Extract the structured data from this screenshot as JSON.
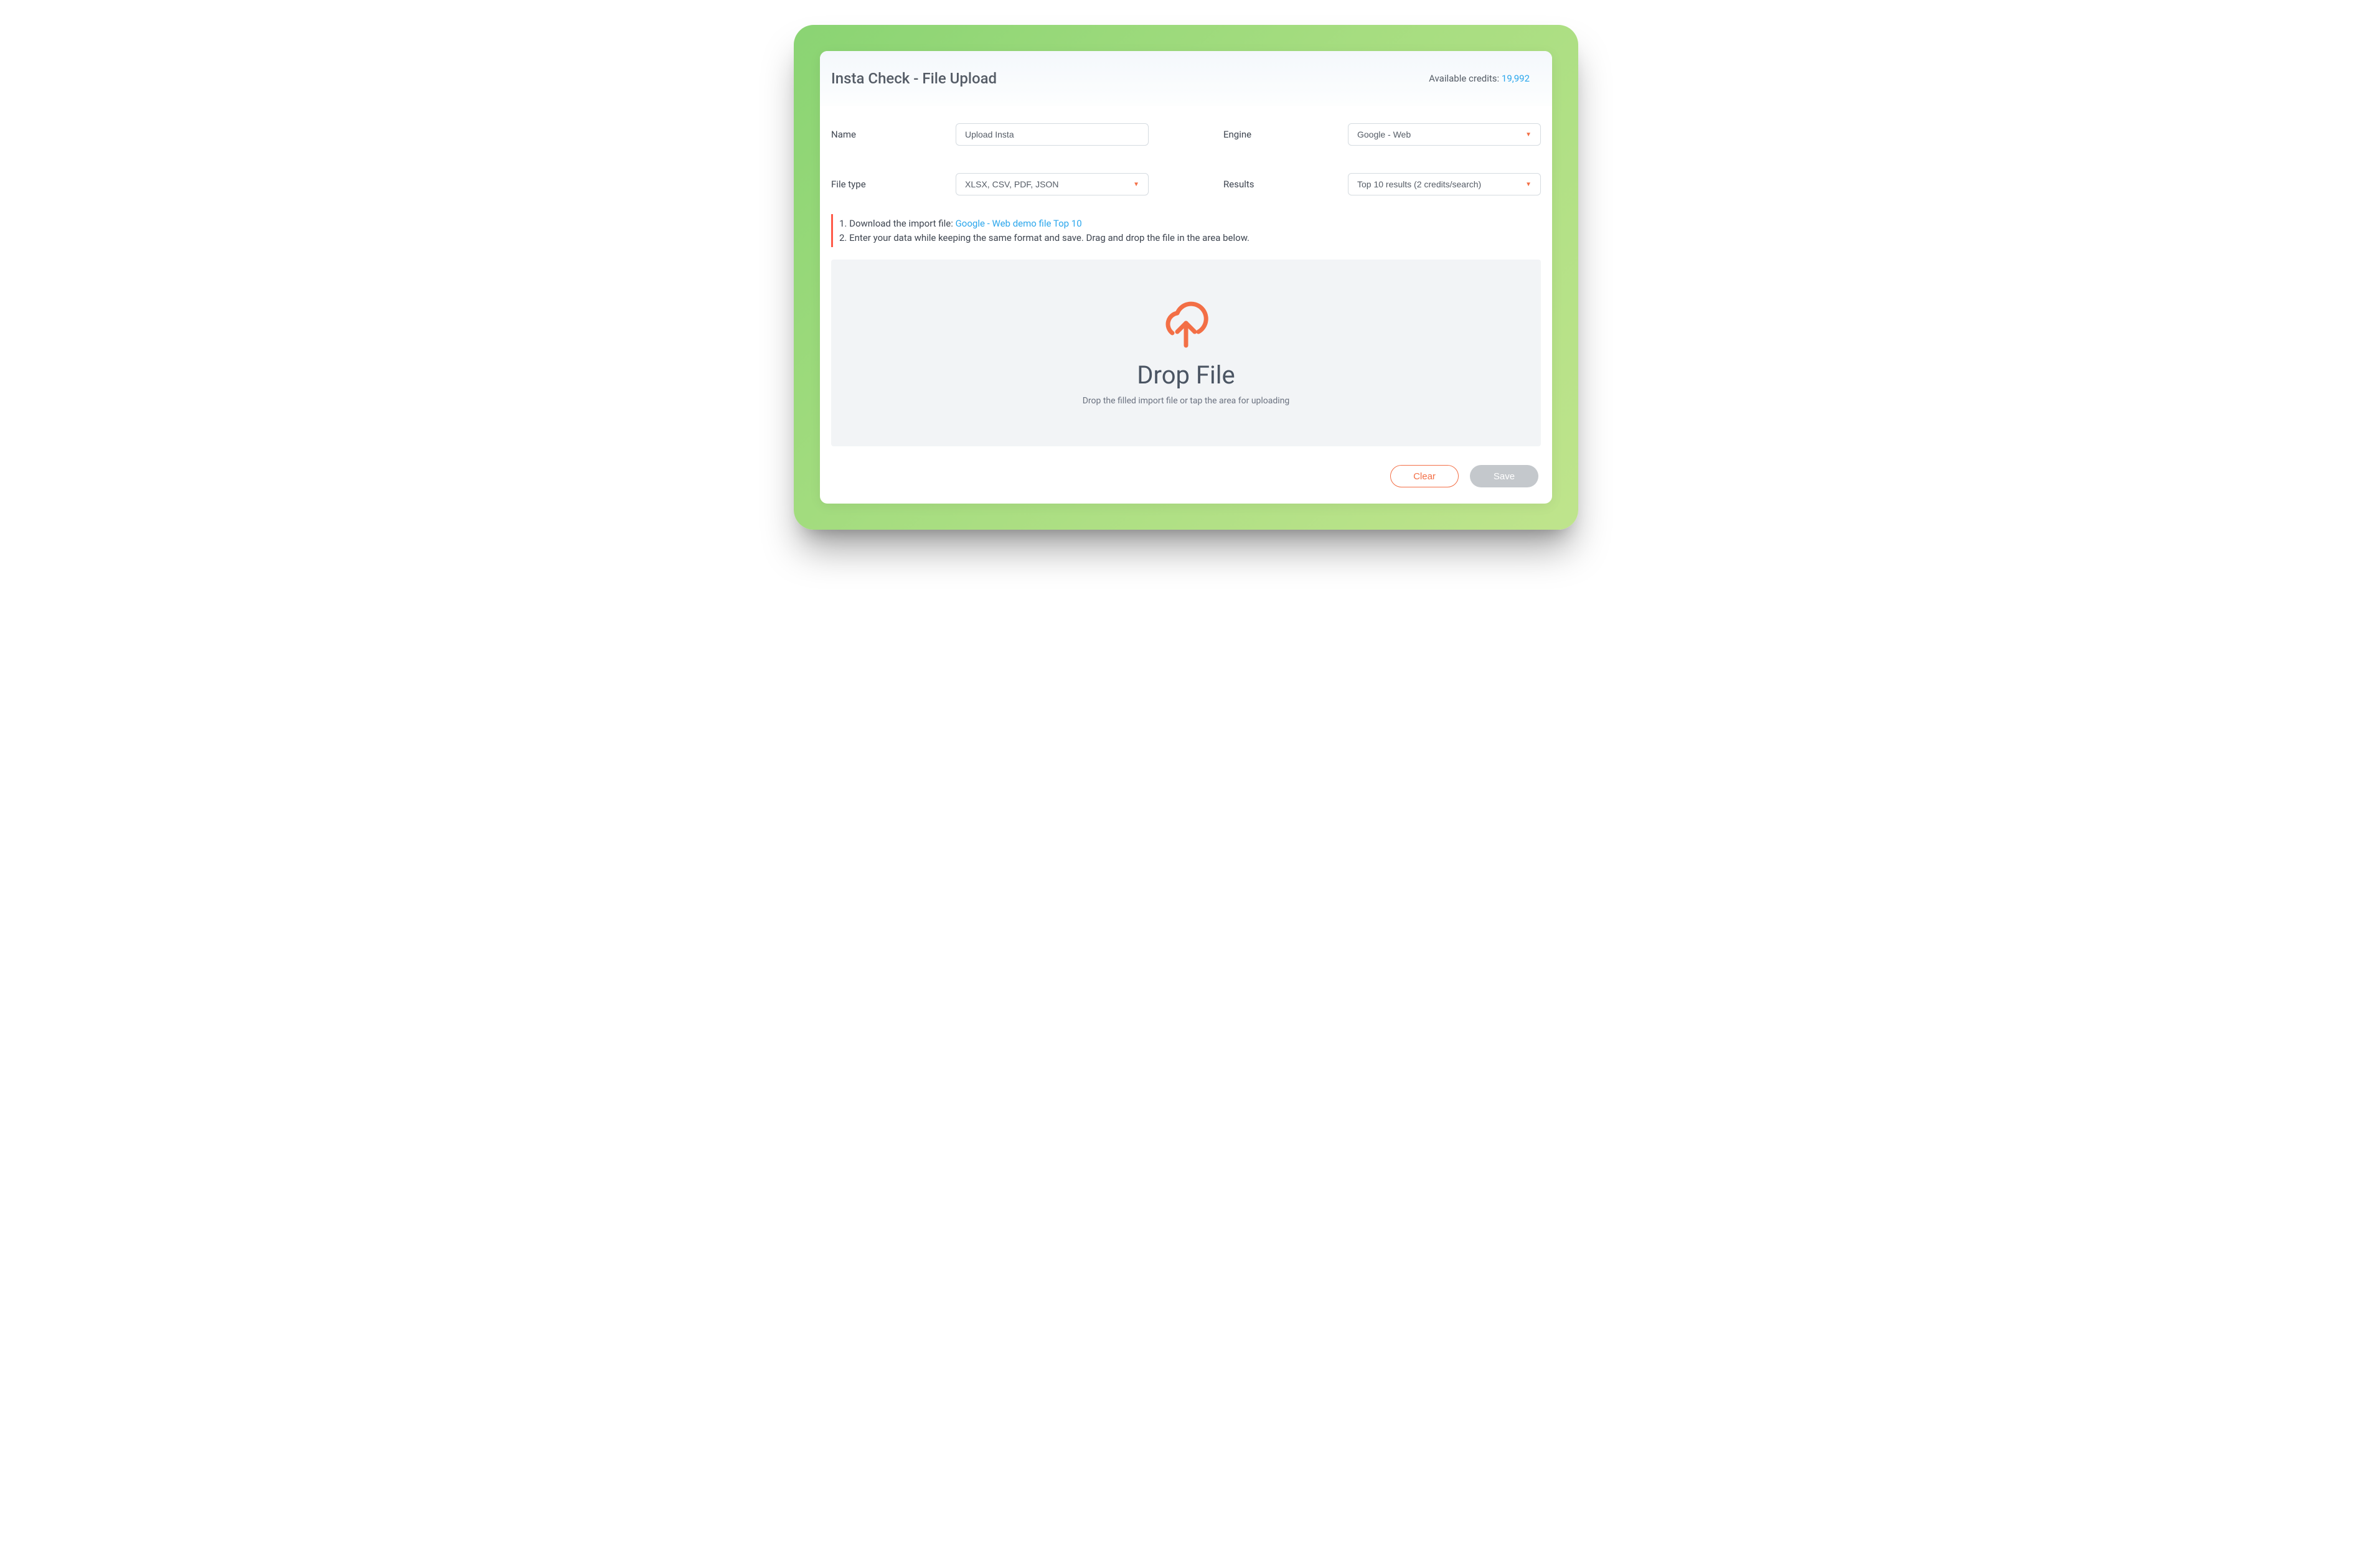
{
  "header": {
    "title": "Insta Check - File Upload",
    "credits_label": "Available credits: ",
    "credits_value": "19,992"
  },
  "form": {
    "name_label": "Name",
    "name_value": "Upload Insta",
    "engine_label": "Engine",
    "engine_value": "Google - Web",
    "file_type_label": "File type",
    "file_type_value": "XLSX, CSV, PDF, JSON",
    "results_label": "Results",
    "results_value": "Top 10 results (2 credits/search)"
  },
  "instructions": {
    "step1_prefix": "1. Download the import file: ",
    "step1_link": "Google - Web demo file Top 10",
    "step2": "2. Enter your data while keeping the same format and save. Drag and drop the file in the area below."
  },
  "drop": {
    "title": "Drop File",
    "subtitle": "Drop the filled import file or tap the area for uploading"
  },
  "actions": {
    "clear": "Clear",
    "save": "Save"
  }
}
